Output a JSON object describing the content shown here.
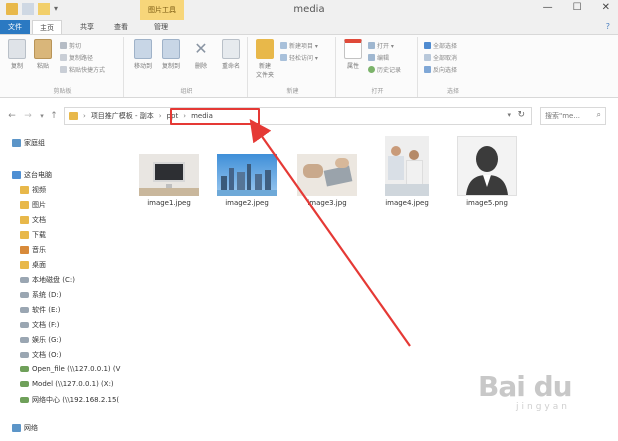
{
  "window": {
    "title": "media",
    "context_tab": "图片工具"
  },
  "tabs": [
    "文件",
    "主页",
    "共享",
    "查看",
    "管理"
  ],
  "ribbon": {
    "groups": [
      "剪贴板",
      "组织",
      "新建",
      "打开",
      "选择"
    ],
    "copy": "复制",
    "paste": "粘贴",
    "cut": "剪切",
    "copy_path": "复制路径",
    "paste_shortcut": "粘贴快捷方式",
    "move_to": "移动到",
    "copy_to": "复制到",
    "delete": "删除",
    "rename": "重命名",
    "new_folder": "新建\n文件夹",
    "new_item": "新建项目 ▾",
    "easy_access": "轻松访问 ▾",
    "properties": "属性",
    "open": "打开 ▾",
    "edit": "编辑",
    "history": "历史记录",
    "select_all": "全部选择",
    "select_none": "全部取消",
    "invert": "反向选择"
  },
  "address": {
    "crumbs": [
      "项目推广模板 - 副本",
      "ppt",
      "media"
    ],
    "search_placeholder": "搜索\"me..."
  },
  "sidebar": {
    "quick_access": "家庭组",
    "this_pc": "这台电脑",
    "items": [
      "视频",
      "图片",
      "文档",
      "下载",
      "音乐",
      "桌面",
      "本地磁盘 (C:)",
      "系统 (D:)",
      "软件 (E:)",
      "文档 (F:)",
      "娱乐 (G:)",
      "文档 (O:)",
      "Open_file (\\\\127.0.0.1) (V",
      "Model (\\\\127.0.0.1) (X:)",
      "网络中心 (\\\\192.168.2.15("
    ],
    "network": "网络"
  },
  "files": [
    {
      "name": "image1.jpeg"
    },
    {
      "name": "image2.jpeg"
    },
    {
      "name": "image3.jpg"
    },
    {
      "name": "image4.jpeg"
    },
    {
      "name": "image5.png"
    }
  ],
  "watermark": {
    "brand": "Bai du",
    "sub": "jingyan"
  }
}
